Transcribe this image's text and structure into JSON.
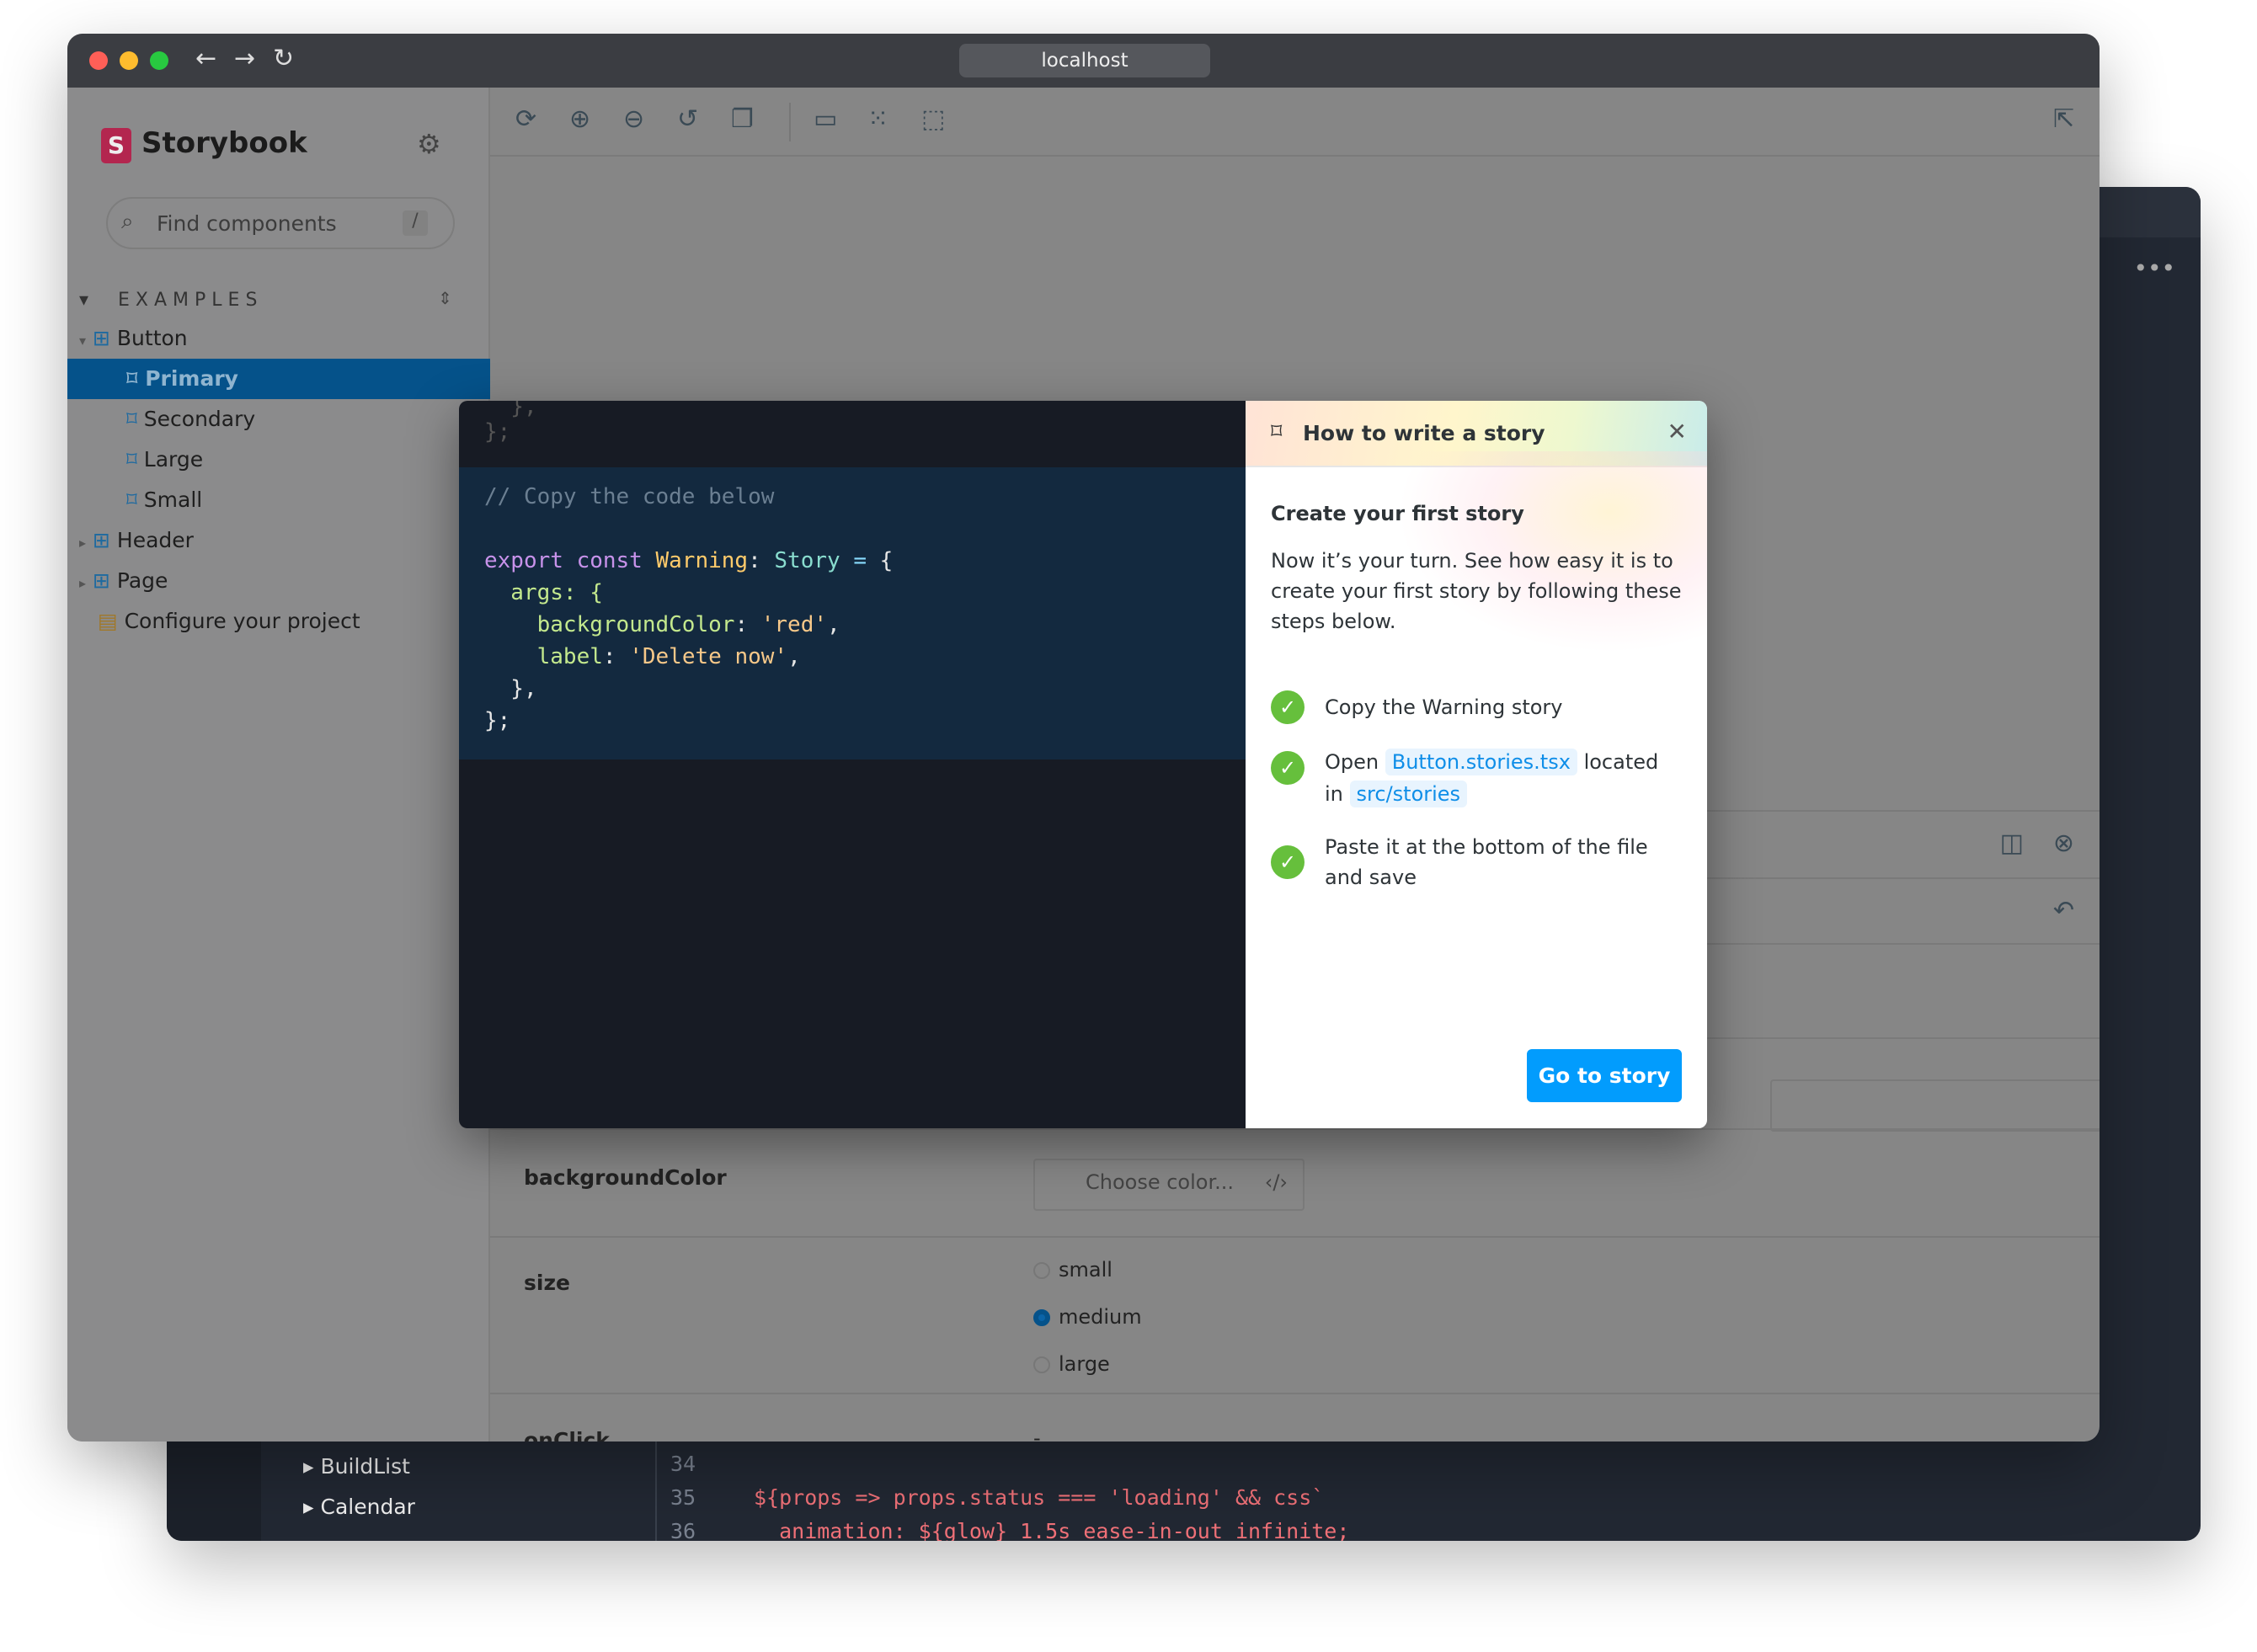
{
  "browser": {
    "url": "localhost"
  },
  "sidebar": {
    "brand": "Storybook",
    "search_placeholder": "Find components",
    "search_shortcut": "/",
    "section": "EXAMPLES",
    "items": [
      {
        "label": "Button",
        "type": "component"
      },
      {
        "label": "Primary",
        "type": "story",
        "selected": true
      },
      {
        "label": "Secondary",
        "type": "story"
      },
      {
        "label": "Large",
        "type": "story"
      },
      {
        "label": "Small",
        "type": "story"
      },
      {
        "label": "Header",
        "type": "component"
      },
      {
        "label": "Page",
        "type": "component"
      },
      {
        "label": "Configure your project",
        "type": "doc"
      }
    ]
  },
  "controls": {
    "rows": [
      {
        "name": "backgroundColor",
        "placeholder": "Choose color..."
      },
      {
        "name": "size",
        "options": [
          "small",
          "medium",
          "large"
        ],
        "selected": "medium"
      },
      {
        "name": "onClick",
        "value": "-"
      }
    ]
  },
  "code": {
    "lines": [
      "  },",
      "};",
      "// Copy the code below",
      "export const Warning: Story = {",
      "  args: {",
      "    backgroundColor: 'red',",
      "    label: 'Delete now',",
      "  },",
      "};"
    ]
  },
  "guide": {
    "title": "How to write a story",
    "heading": "Create your first story",
    "intro": "Now it’s your turn. See how easy it is to create your first story by following these steps below.",
    "step1": "Copy the Warning story",
    "step2_a": "Open",
    "step2_file": "Button.stories.tsx",
    "step2_b": "located",
    "step2_c": "in",
    "step2_dir": "src/stories",
    "step3": "Paste it at the bottom of the file and save",
    "button": "Go to story"
  },
  "back_window": {
    "tree": [
      "BuildList",
      "Calendar"
    ],
    "line_numbers": [
      "34",
      "35",
      "36"
    ],
    "code": [
      "",
      "${props => props.status === 'loading' && css`",
      "  animation: ${glow} 1.5s ease-in-out infinite;"
    ]
  },
  "colors": {
    "accent": "#029cfd",
    "selected": "#05528a",
    "check": "#66bf3c",
    "brand": "#ff4785"
  }
}
